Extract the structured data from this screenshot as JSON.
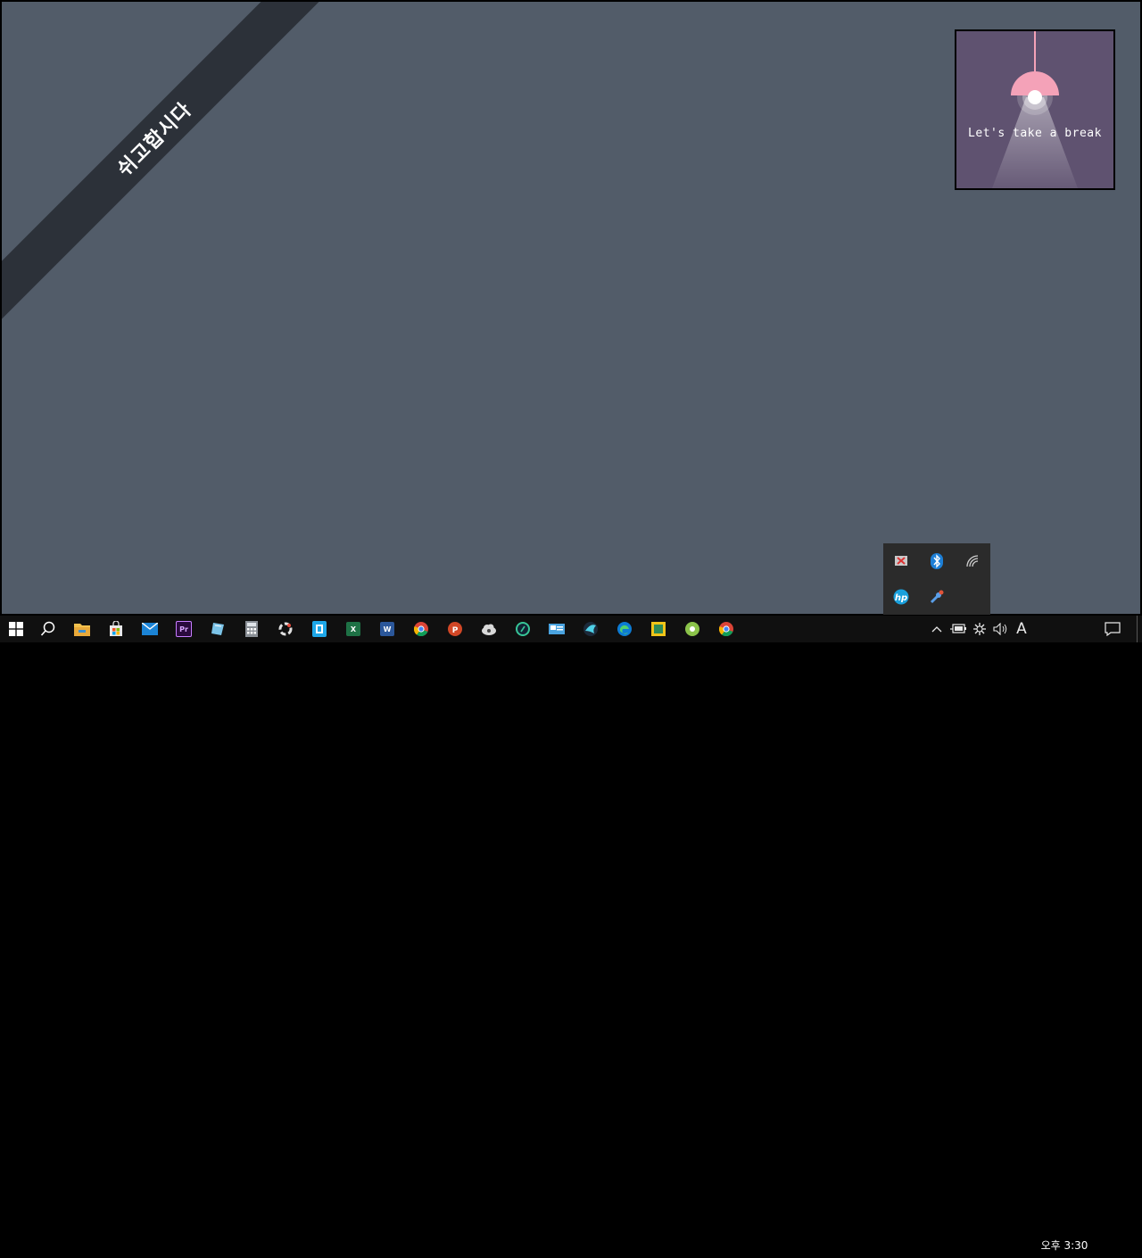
{
  "desktop": {
    "ribbon_text": "쉬고합시다",
    "break_card": {
      "caption": "Let's take a break"
    }
  },
  "tray_popup": {
    "icons": [
      "disconnected-device-icon",
      "bluetooth-icon",
      "wireless-icon",
      "hp-icon",
      "tool-update-icon"
    ]
  },
  "taskbar": {
    "apps": [
      "start-icon",
      "search-icon",
      "file-explorer-icon",
      "store-icon",
      "mail-icon",
      "premiere-icon",
      "notebook-app-icon",
      "calculator-icon",
      "settings-ring-icon",
      "blue-app-icon",
      "excel-icon",
      "word-icon",
      "chrome-icon",
      "powerpoint-icon",
      "cloud-app-icon",
      "green-circle-icon",
      "screen-app-icon",
      "bird-app-icon",
      "edge-icon",
      "photo-frame-icon",
      "green-app-icon",
      "chrome-alt-icon"
    ],
    "system": {
      "ime_label": "A",
      "clock": "오후 3:30"
    }
  },
  "colors": {
    "desktop_bg": "#525c69",
    "ribbon_bg": "#2c3139",
    "card_bg": "#5f5270",
    "lamp_pink": "#f4a2b8",
    "taskbar_bg": "#101010"
  }
}
